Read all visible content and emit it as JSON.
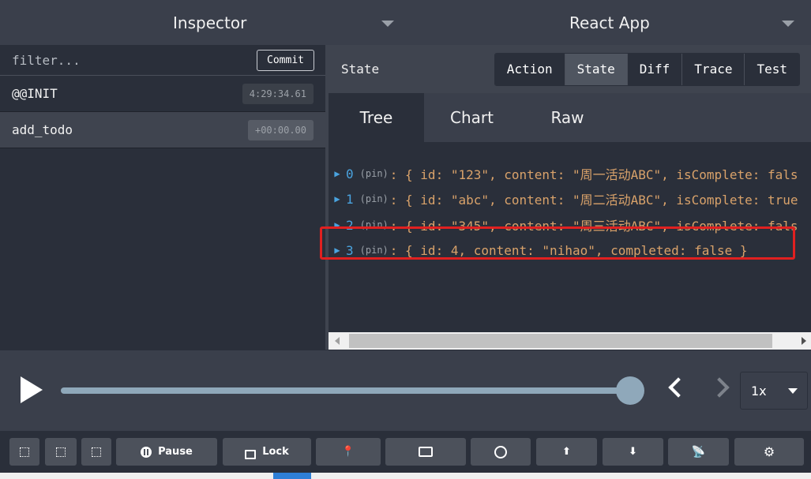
{
  "topbar": {
    "left_title": "Inspector",
    "right_title": "React App"
  },
  "left": {
    "filter_placeholder": "filter...",
    "commit_label": "Commit",
    "actions": [
      {
        "name": "@@INIT",
        "time": "4:29:34.61"
      },
      {
        "name": "add_todo",
        "time": "+00:00.00"
      }
    ]
  },
  "right": {
    "header_label": "State",
    "seg_buttons": [
      "Action",
      "State",
      "Diff",
      "Trace",
      "Test"
    ],
    "active_seg": "State",
    "tabs": [
      "Tree",
      "Chart",
      "Raw"
    ],
    "active_tab": "Tree",
    "rows": [
      {
        "index": "0",
        "pin": "(pin)",
        "body": ": { id: \"123\", content: \"周一活动ABC\", isComplete: fals"
      },
      {
        "index": "1",
        "pin": "(pin)",
        "body": ": { id: \"abc\", content: \"周二活动ABC\", isComplete: true"
      },
      {
        "index": "2",
        "pin": "(pin)",
        "body": ": { id: \"345\", content: \"周三活动ABC\", isComplete: fals"
      },
      {
        "index": "3",
        "pin": "(pin)",
        "body": ": { id: 4, content: \"nihao\", completed: false }"
      }
    ],
    "highlight_color": "#e02020"
  },
  "slider": {
    "speed": "1x",
    "position_fraction": 1.0
  },
  "toolbar": {
    "pause_label": "Pause",
    "lock_label": "Lock"
  },
  "colors": {
    "accent_blue": "#4aa3df",
    "value_orange": "#d9a26a",
    "bg_dark": "#2a2f3a"
  }
}
